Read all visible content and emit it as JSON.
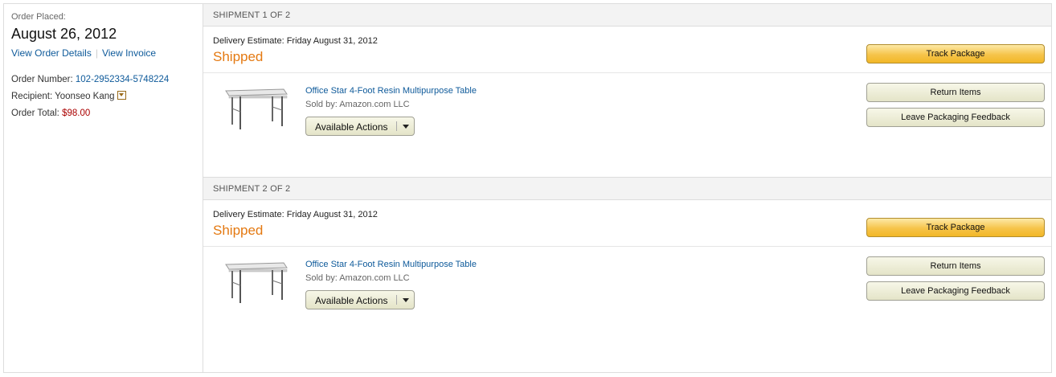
{
  "order": {
    "placed_label": "Order Placed:",
    "placed_date": "August 26, 2012",
    "view_details": "View Order Details",
    "view_invoice": "View Invoice",
    "number_label": "Order Number:",
    "number": "102-2952334-5748224",
    "recipient_label": "Recipient:",
    "recipient": "Yoonseo Kang",
    "total_label": "Order Total:",
    "total": "$98.00"
  },
  "shipments": [
    {
      "header": "SHIPMENT 1 OF 2",
      "delivery": "Delivery Estimate: Friday August 31, 2012",
      "status": "Shipped",
      "track": "Track Package",
      "return": "Return Items",
      "feedback": "Leave Packaging Feedback",
      "item": {
        "title": "Office Star 4-Foot Resin Multipurpose Table",
        "sold_by": "Sold by: Amazon.com LLC",
        "actions": "Available Actions",
        "thumb_icon": "folding-table-image"
      }
    },
    {
      "header": "SHIPMENT 2 OF 2",
      "delivery": "Delivery Estimate: Friday August 31, 2012",
      "status": "Shipped",
      "track": "Track Package",
      "return": "Return Items",
      "feedback": "Leave Packaging Feedback",
      "item": {
        "title": "Office Star 4-Foot Resin Multipurpose Table",
        "sold_by": "Sold by: Amazon.com LLC",
        "actions": "Available Actions",
        "thumb_icon": "folding-table-image"
      }
    }
  ],
  "colors": {
    "status_orange": "#e47911",
    "link_blue": "#0e5a9a",
    "price_red": "#aa0000"
  }
}
